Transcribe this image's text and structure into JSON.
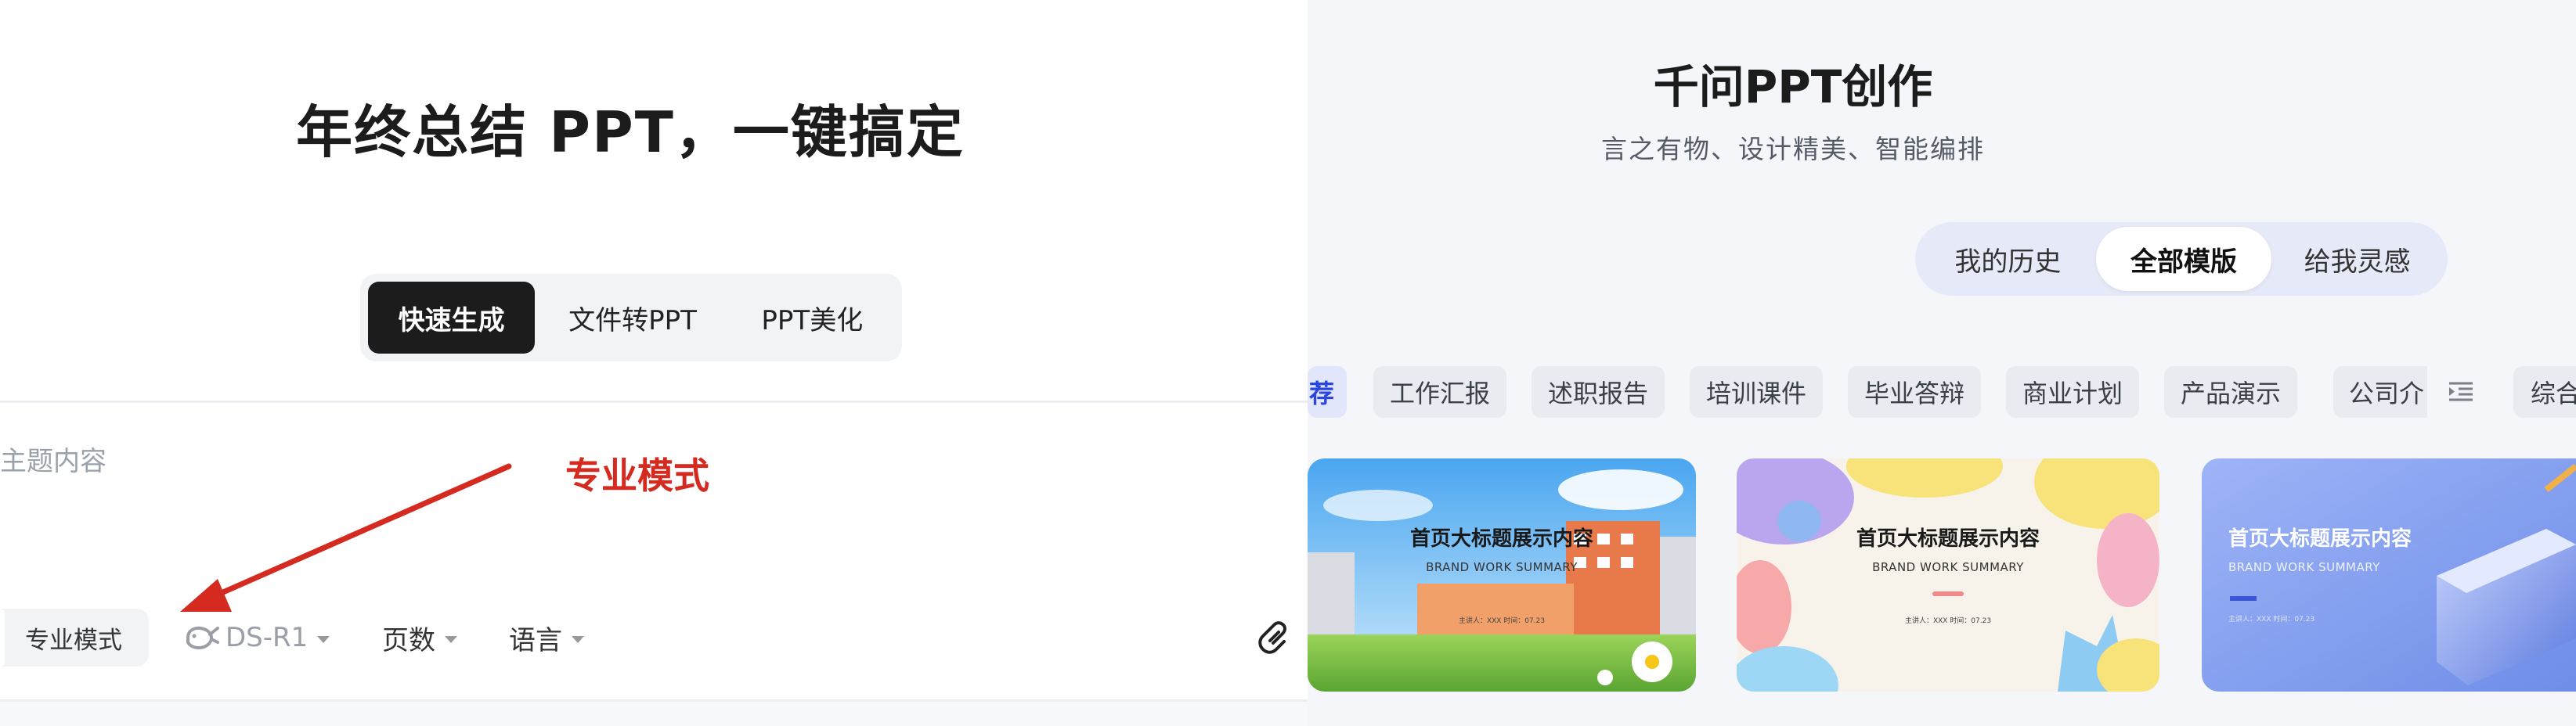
{
  "left": {
    "title": "年终总结 PPT，一键搞定",
    "mode_tabs": [
      "快速生成",
      "文件转PPT",
      "PPT美化"
    ],
    "topic_placeholder": "主题内容",
    "annotation": "专业模式",
    "toolbar": {
      "pro_mode": "专业模式",
      "model": "DS-R1",
      "pages": "页数",
      "language": "语言"
    }
  },
  "right": {
    "title": "千问PPT创作",
    "subtitle": "言之有物、设计精美、智能编排",
    "source_tabs": [
      "我的历史",
      "全部模版",
      "给我灵感"
    ],
    "active_source_tab": "全部模版",
    "categories": [
      "荐",
      "工作汇报",
      "述职报告",
      "培训课件",
      "毕业答辩",
      "商业计划",
      "产品演示",
      "公司介",
      "综合"
    ],
    "active_category": "荐",
    "templates": [
      {
        "title": "首页大标题展示内容",
        "subtitle": "BRAND WORK SUMMARY",
        "meta": "主讲人：XXX 时间：07.23",
        "theme": "campus"
      },
      {
        "title": "首页大标题展示内容",
        "subtitle": "BRAND WORK SUMMARY",
        "meta": "主讲人：XXX 时间：07.23",
        "theme": "cartoon"
      },
      {
        "title": "首页大标题展示内容",
        "subtitle": "BRAND WORK SUMMARY",
        "meta": "主讲人：XXX 时间：07.23",
        "theme": "books"
      }
    ]
  },
  "colors": {
    "accent_red": "#d42a20",
    "active_blue": "#2b45e0",
    "dark_tab": "#1c1c1c",
    "source_tabs_bg": "#e6e9f8"
  },
  "icons": [
    "whale-icon",
    "caret-down-icon",
    "attachment-icon",
    "list-indent-icon",
    "arrow-annotation"
  ]
}
